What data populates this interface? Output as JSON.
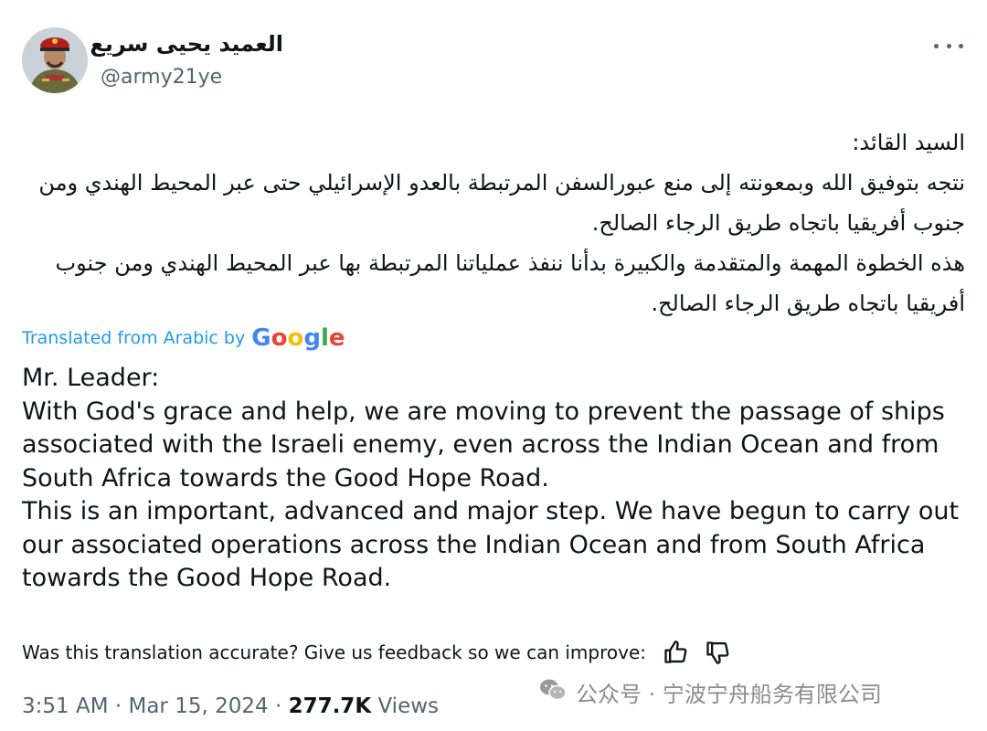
{
  "author": {
    "display_name": "العميد يحيى سريع",
    "handle": "@army21ye",
    "avatar_icon": "profile-photo-military-officer"
  },
  "more_icon": "more-horizontal-icon",
  "tweet_arabic": [
    "السيد القائد:",
    "نتجه بتوفيق الله وبمعونته إلى منع عبورالسفن المرتبطة بالعدو الإسرائيلي حتى عبر المحيط الهندي ومن جنوب أفريقيا باتجاه طريق الرجاء الصالح.",
    "هذه الخطوة المهمة والمتقدمة والكبيرة بدأنا ننفذ عملياتنا المرتبطة بها عبر المحيط الهندي ومن جنوب أفريقيا باتجاه طريق الرجاء الصالح."
  ],
  "translation": {
    "label": "Translated from Arabic by",
    "provider": "Google",
    "lines": [
      "Mr. Leader:",
      "With God's grace and help, we are moving to prevent the passage of ships associated with the Israeli enemy, even across the Indian Ocean and from South Africa towards the Good Hope Road.",
      "This is an important, advanced and major step. We have begun to carry out our associated operations across the Indian Ocean and from South Africa towards the Good Hope Road."
    ],
    "feedback_prompt": "Was this translation accurate? Give us feedback so we can improve:"
  },
  "meta": {
    "time": "3:51 AM",
    "separator": "·",
    "date": "Mar 15, 2024",
    "views_count": "277.7K",
    "views_label": "Views"
  },
  "watermark": {
    "text": "公众号 · 宁波宁舟船务有限公司",
    "icon": "wechat-icon"
  },
  "colors": {
    "link_blue": "#1d9bf0",
    "secondary_text": "#536471",
    "primary_text": "#0f1419"
  }
}
